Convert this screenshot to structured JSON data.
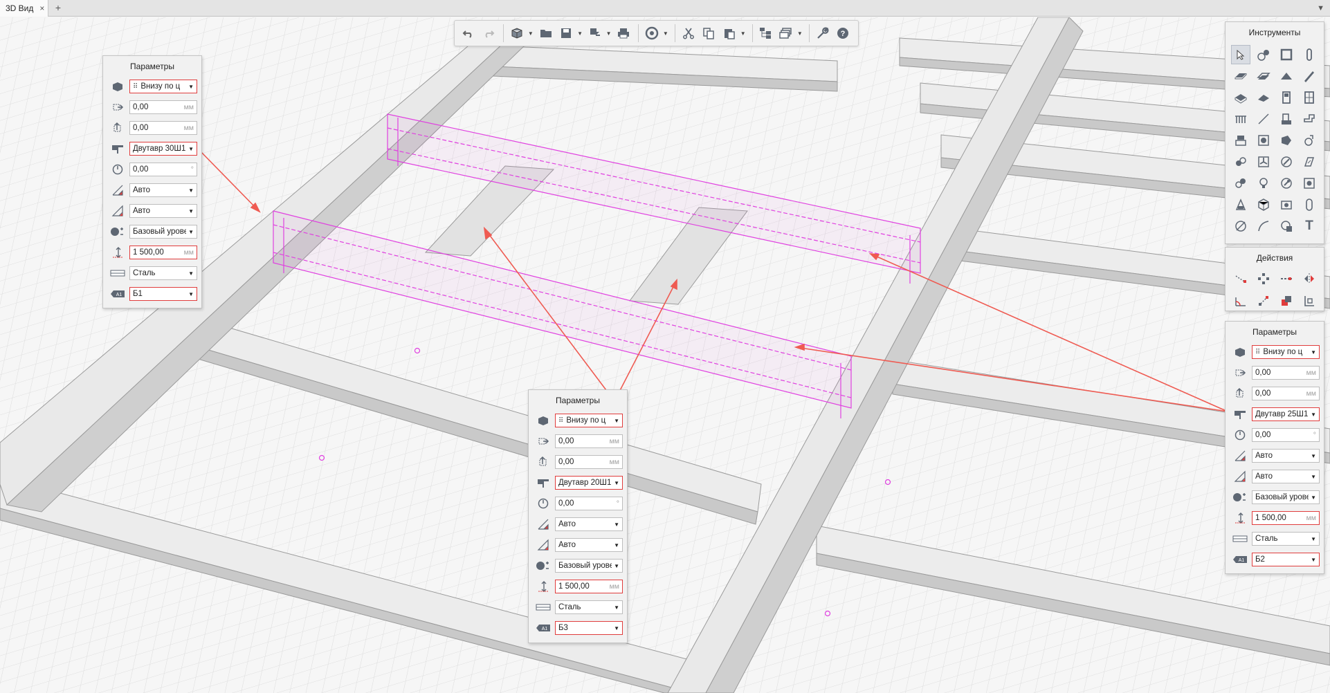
{
  "tabbar": {
    "tab_label": "3D Вид",
    "close_glyph": "×",
    "add_glyph": "+",
    "menu_glyph": "▼"
  },
  "toolbar": {
    "icons": [
      "undo-icon",
      "redo-icon",
      "3d-view-icon",
      "open-folder-icon",
      "save-icon",
      "export-icon",
      "print-icon",
      "orbit-icon",
      "cut-icon",
      "copy-icon",
      "paste-icon",
      "hierarchy-icon",
      "layers-icon",
      "wrench-icon",
      "help-icon"
    ]
  },
  "tools_panel": {
    "title": "Инструменты",
    "text_tool_glyph": "T"
  },
  "actions_panel": {
    "title": "Действия"
  },
  "params_left": {
    "title": "Параметры",
    "placement": "Внизу по ц",
    "offset_x": "0,00",
    "offset_y": "0,00",
    "unit": "мм",
    "profile": "Двутавр 30Ш1",
    "rotation": "0,00",
    "degree": "°",
    "start_cut": "Авто",
    "end_cut": "Авто",
    "level": "Базовый урове",
    "height": "1 500,00",
    "material": "Сталь",
    "mark": "Б1"
  },
  "params_center": {
    "title": "Параметры",
    "placement": "Внизу по ц",
    "offset_x": "0,00",
    "offset_y": "0,00",
    "unit": "мм",
    "profile": "Двутавр 20Ш1",
    "rotation": "0,00",
    "degree": "°",
    "start_cut": "Авто",
    "end_cut": "Авто",
    "level": "Базовый урове",
    "height": "1 500,00",
    "material": "Сталь",
    "mark": "Б3"
  },
  "params_right": {
    "title": "Параметры",
    "placement": "Внизу по ц",
    "offset_x": "0,00",
    "offset_y": "0,00",
    "unit": "мм",
    "profile": "Двутавр 25Ш1",
    "rotation": "0,00",
    "degree": "°",
    "start_cut": "Авто",
    "end_cut": "Авто",
    "level": "Базовый урове",
    "height": "1 500,00",
    "material": "Сталь",
    "mark": "Б2"
  },
  "colors": {
    "selection": "#e040e0",
    "callout": "#ef5b52",
    "beam_top": "#ececec",
    "beam_side": "#c9c9c9",
    "grid": "#dadada"
  }
}
